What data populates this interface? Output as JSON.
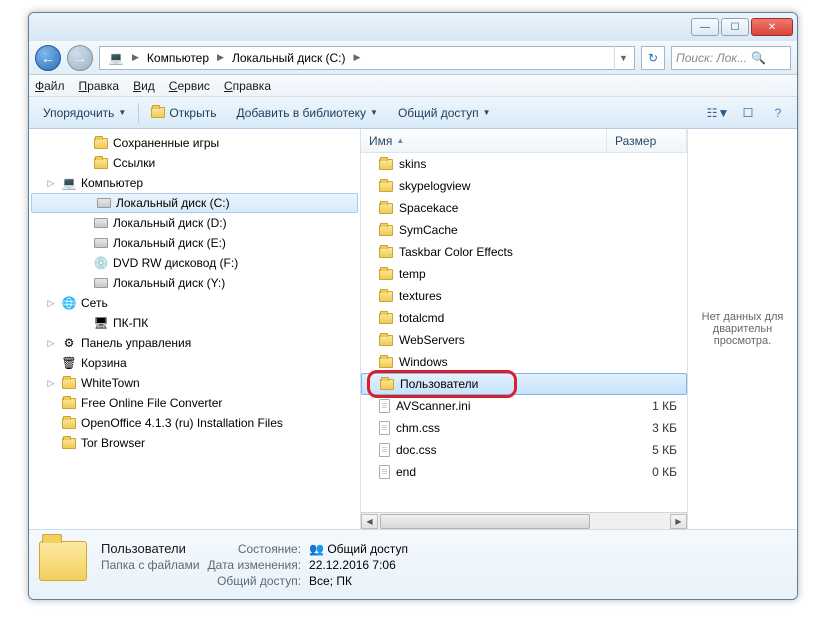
{
  "breadcrumb": {
    "root": "Компьютер",
    "drive": "Локальный диск (C:)"
  },
  "search": {
    "placeholder": "Поиск: Лок..."
  },
  "menu": {
    "file": "Файл",
    "edit": "Правка",
    "view": "Вид",
    "tools": "Сервис",
    "help": "Справка"
  },
  "toolbar": {
    "organize": "Упорядочить",
    "open": "Открыть",
    "library": "Добавить в библиотеку",
    "share": "Общий доступ"
  },
  "columns": {
    "name": "Имя",
    "size": "Размер"
  },
  "tree": [
    {
      "indent": 48,
      "icon": "folder",
      "label": "Сохраненные игры"
    },
    {
      "indent": 48,
      "icon": "folder",
      "label": "Ссылки"
    },
    {
      "indent": 16,
      "icon": "computer",
      "label": "Компьютер",
      "exp": "▷"
    },
    {
      "indent": 48,
      "icon": "drive",
      "label": "Локальный диск (C:)",
      "sel": true
    },
    {
      "indent": 48,
      "icon": "drive",
      "label": "Локальный диск (D:)"
    },
    {
      "indent": 48,
      "icon": "drive",
      "label": "Локальный диск (E:)"
    },
    {
      "indent": 48,
      "icon": "disc",
      "label": "DVD RW дисковод (F:)"
    },
    {
      "indent": 48,
      "icon": "drive",
      "label": "Локальный диск (Y:)"
    },
    {
      "indent": 16,
      "icon": "network",
      "label": "Сеть",
      "exp": "▷"
    },
    {
      "indent": 48,
      "icon": "pc",
      "label": "ПК-ПК"
    },
    {
      "indent": 16,
      "icon": "cpanel",
      "label": "Панель управления",
      "exp": "▷"
    },
    {
      "indent": 16,
      "icon": "recycle",
      "label": "Корзина"
    },
    {
      "indent": 16,
      "icon": "folder",
      "label": "WhiteTown",
      "exp": "▷"
    },
    {
      "indent": 16,
      "icon": "folder",
      "label": "Free Online File Converter"
    },
    {
      "indent": 16,
      "icon": "folder",
      "label": "OpenOffice 4.1.3 (ru) Installation Files"
    },
    {
      "indent": 16,
      "icon": "folder",
      "label": "Tor Browser"
    }
  ],
  "files": [
    {
      "type": "folder",
      "name": "skins",
      "size": ""
    },
    {
      "type": "folder",
      "name": "skypelogview",
      "size": ""
    },
    {
      "type": "folder",
      "name": "Spacekace",
      "size": ""
    },
    {
      "type": "folder",
      "name": "SymCache",
      "size": ""
    },
    {
      "type": "folder",
      "name": "Taskbar Color Effects",
      "size": ""
    },
    {
      "type": "folder",
      "name": "temp",
      "size": ""
    },
    {
      "type": "folder",
      "name": "textures",
      "size": ""
    },
    {
      "type": "folder",
      "name": "totalcmd",
      "size": ""
    },
    {
      "type": "folder",
      "name": "WebServers",
      "size": ""
    },
    {
      "type": "folder",
      "name": "Windows",
      "size": ""
    },
    {
      "type": "folder",
      "name": "Пользователи",
      "size": "",
      "sel": true,
      "highlight": true
    },
    {
      "type": "file",
      "name": "AVScanner.ini",
      "size": "1 КБ"
    },
    {
      "type": "file",
      "name": "chm.css",
      "size": "3 КБ"
    },
    {
      "type": "file",
      "name": "doc.css",
      "size": "5 КБ"
    },
    {
      "type": "file",
      "name": "end",
      "size": "0 КБ"
    }
  ],
  "preview": {
    "text": "Нет данных для дварительн просмотра."
  },
  "details": {
    "name": "Пользователи",
    "type": "Папка с файлами",
    "state_lbl": "Состояние:",
    "state_val": "Общий доступ",
    "mod_lbl": "Дата изменения:",
    "mod_val": "22.12.2016 7:06",
    "share_lbl": "Общий доступ:",
    "share_val": "Все; ПК"
  }
}
